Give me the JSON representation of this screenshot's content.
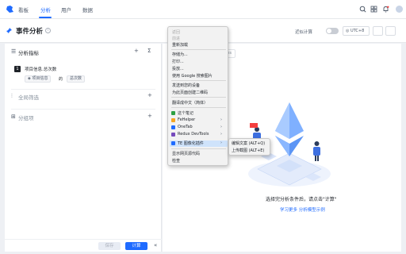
{
  "topnav": {
    "tabs": [
      "看板",
      "分析",
      "用户",
      "数据"
    ],
    "active_tab": "分析"
  },
  "titlebar": {
    "title": "事件分析",
    "near_calc_label": "近似计算",
    "timezone": "UTC+8"
  },
  "left": {
    "metrics_title": "分析指标",
    "metric": {
      "index": "1",
      "name": "项目信息.总次数",
      "chip_event": "项目信息",
      "chip_of": "的",
      "chip_agg": "总次数"
    },
    "global_filter": "全局筛选",
    "group_by": "分组项",
    "save_label": "保存",
    "calc_label": "计算",
    "collapse_icon": "double-chevron-left-icon"
  },
  "right": {
    "chip_suffix": "ms",
    "empty_title": "选择完分析条件后，请点击\"计算\"",
    "empty_link": "学习更多 分析模型示例"
  },
  "context_menu": {
    "items": [
      {
        "label": "返回",
        "disabled": true
      },
      {
        "label": "前进",
        "disabled": true
      },
      {
        "label": "重新加载",
        "disabled": false
      },
      {
        "label": "存储为...",
        "disabled": false
      },
      {
        "label": "打印...",
        "disabled": false
      },
      {
        "label": "投放...",
        "disabled": false
      },
      {
        "label": "使用 Google 搜索图片",
        "disabled": false
      },
      {
        "label": "发送到您的设备",
        "disabled": false
      },
      {
        "label": "为此页面创建二维码",
        "disabled": false
      },
      {
        "label": "翻译成中文（简体）",
        "disabled": false
      },
      {
        "label": "这个笔记",
        "disabled": false
      },
      {
        "label": "FeHelper",
        "disabled": false
      },
      {
        "label": "OneTab",
        "disabled": false
      },
      {
        "label": "Redux DevTools",
        "disabled": false
      },
      {
        "label": "TE 图像化插件",
        "disabled": false
      },
      {
        "label": "显示网页源代码",
        "disabled": false
      },
      {
        "label": "检查",
        "disabled": false
      }
    ],
    "submenu": [
      "编辑文案 (ALT+Q)",
      "上传截图 (ALT+E)"
    ]
  },
  "colors": {
    "accent": "#1f6bff",
    "menu_highlight": "#cfe3fb"
  }
}
